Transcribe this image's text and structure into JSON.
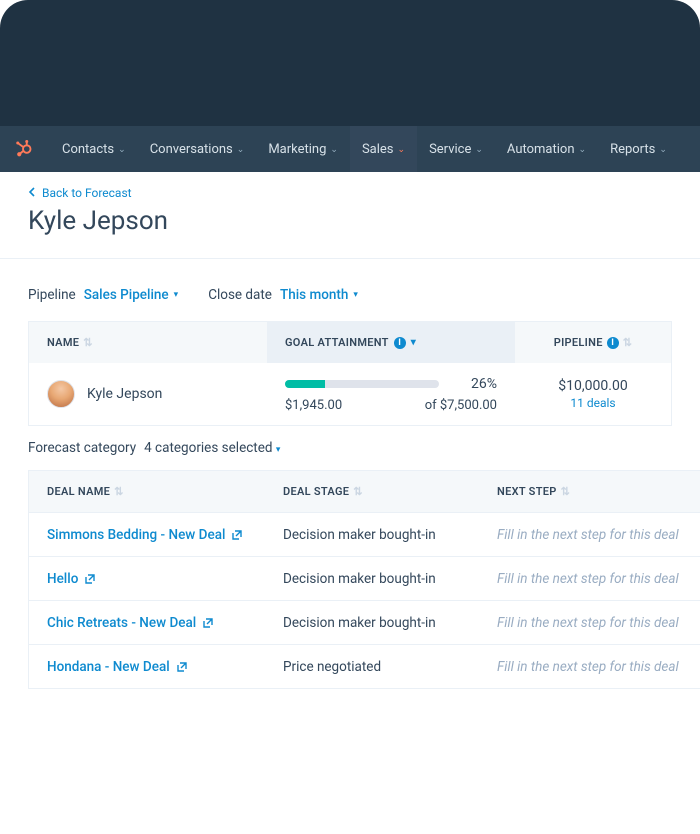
{
  "nav": {
    "items": [
      "Contacts",
      "Conversations",
      "Marketing",
      "Sales",
      "Service",
      "Automation",
      "Reports"
    ],
    "active_index": 3
  },
  "header": {
    "backlink": "Back to Forecast",
    "page_title": "Kyle Jepson"
  },
  "filters": {
    "pipeline_label": "Pipeline",
    "pipeline_value": "Sales Pipeline",
    "closedate_label": "Close date",
    "closedate_value": "This month"
  },
  "summary": {
    "cols": {
      "name": "NAME",
      "goal": "GOAL ATTAINMENT",
      "pipe": "PIPELINE"
    },
    "row": {
      "name": "Kyle Jepson",
      "goal_pct_text": "26%",
      "goal_pct": 26,
      "current": "$1,945.00",
      "target": "of $7,500.00",
      "pipeline_amount": "$10,000.00",
      "pipeline_deals": "11 deals"
    }
  },
  "cat": {
    "label": "Forecast category",
    "value": "4 categories selected"
  },
  "deals": {
    "cols": {
      "name": "DEAL NAME",
      "stage": "DEAL STAGE",
      "next": "NEXT STEP"
    },
    "rows": [
      {
        "name": "Simmons Bedding - New Deal",
        "stage": "Decision maker bought-in",
        "next": "Fill in the next step for this deal"
      },
      {
        "name": "Hello",
        "stage": "Decision maker bought-in",
        "next": "Fill in the next step for this deal"
      },
      {
        "name": "Chic Retreats - New Deal",
        "stage": "Decision maker bought-in",
        "next": "Fill in the next step for this deal"
      },
      {
        "name": "Hondana - New Deal",
        "stage": "Price negotiated",
        "next": "Fill in the next step for this deal"
      }
    ]
  }
}
